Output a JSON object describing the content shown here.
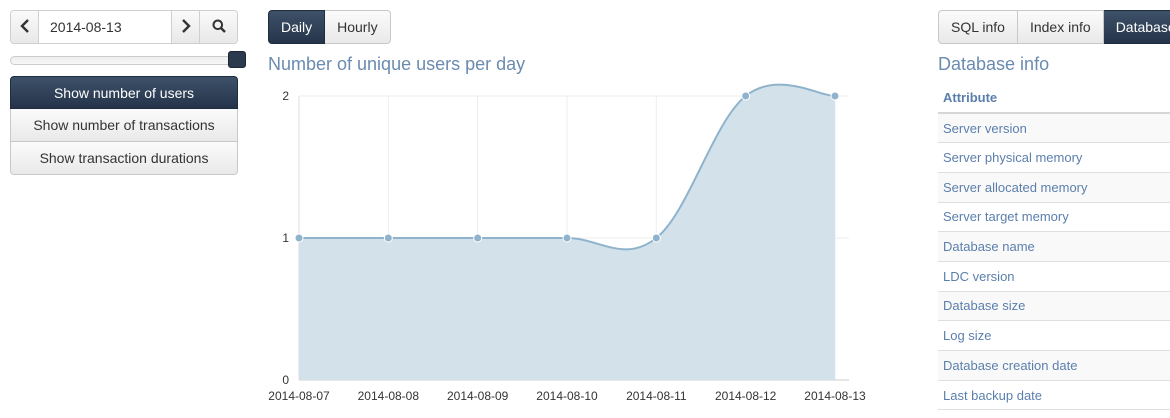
{
  "date_nav": {
    "date_value": "2014-08-13",
    "prev_icon": "chevron-left-icon",
    "next_icon": "chevron-right-icon",
    "search_icon": "search-icon"
  },
  "slider": {
    "value": 1.0
  },
  "metric_menu": {
    "items": [
      {
        "label": "Show number of users",
        "active": true
      },
      {
        "label": "Show number of transactions",
        "active": false
      },
      {
        "label": "Show transaction durations",
        "active": false
      }
    ]
  },
  "granularity": {
    "daily": "Daily",
    "hourly": "Hourly",
    "active": "daily"
  },
  "chart": {
    "title": "Number of unique users per day"
  },
  "chart_data": {
    "type": "area",
    "title": "Number of unique users per day",
    "x": [
      "2014-08-07",
      "2014-08-08",
      "2014-08-09",
      "2014-08-10",
      "2014-08-11",
      "2014-08-12",
      "2014-08-13"
    ],
    "series": [
      {
        "values": [
          1,
          1,
          1,
          1,
          1,
          2,
          2
        ]
      }
    ],
    "yticks": [
      "0",
      "1",
      "2"
    ],
    "ylim": [
      0,
      2
    ],
    "xlabel": "",
    "ylabel": "",
    "grid": true,
    "colors": {
      "line": "#8fb3cc",
      "fill": "#d3e2ea",
      "point": "#8fb3cc"
    }
  },
  "tabs": {
    "items": [
      {
        "label": "SQL info",
        "active": false
      },
      {
        "label": "Index info",
        "active": false
      },
      {
        "label": "Database info",
        "active": true
      }
    ]
  },
  "db_info": {
    "title": "Database info",
    "header": "Attribute",
    "rows": [
      "Server version",
      "Server physical memory",
      "Server allocated memory",
      "Server target memory",
      "Database name",
      "LDC version",
      "Database size",
      "Log size",
      "Database creation date",
      "Last backup date"
    ]
  },
  "colors": {
    "accent_dark": "#2b3a4c",
    "title_blue": "#6a8bb0",
    "link_blue": "#5b7fad"
  }
}
